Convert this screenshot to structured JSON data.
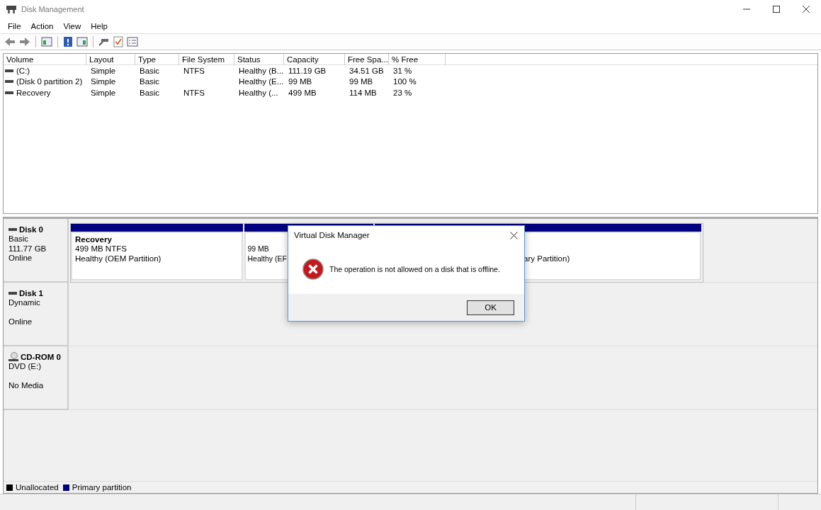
{
  "window": {
    "title": "Disk Management"
  },
  "menu": [
    "File",
    "Action",
    "View",
    "Help"
  ],
  "table": {
    "columns": [
      "Volume",
      "Layout",
      "Type",
      "File System",
      "Status",
      "Capacity",
      "Free Spa...",
      "% Free"
    ],
    "rows": [
      [
        "(C:)",
        "Simple",
        "Basic",
        "NTFS",
        "Healthy (B...",
        "111.19 GB",
        "34.51 GB",
        "31 %"
      ],
      [
        "(Disk 0 partition 2)",
        "Simple",
        "Basic",
        "",
        "Healthy (E...",
        "99 MB",
        "99 MB",
        "100 %"
      ],
      [
        "Recovery",
        "Simple",
        "Basic",
        "NTFS",
        "Healthy (...",
        "499 MB",
        "114 MB",
        "23 %"
      ]
    ]
  },
  "disks": [
    {
      "kind": "hdd",
      "name": "Disk 0",
      "type": "Basic",
      "size": "111.77 GB",
      "status": "Online",
      "partitions": [
        {
          "color": "#000080",
          "title": "Recovery",
          "size": "499 MB NTFS",
          "status": "Healthy (OEM Partition)"
        },
        {
          "color": "#000080",
          "size": "99 MB",
          "status": "Healthy (EF"
        },
        {
          "color": "#000080",
          "status": "ary Partition)"
        }
      ]
    },
    {
      "kind": "hdd",
      "name": "Disk 1",
      "type": "Dynamic",
      "status": "Online"
    },
    {
      "kind": "cdrom",
      "name": "CD-ROM 0",
      "type": "DVD (E:)",
      "status": "No Media"
    }
  ],
  "legend": [
    {
      "label": "Unallocated",
      "color": "#000000"
    },
    {
      "label": "Primary partition",
      "color": "#000080"
    }
  ],
  "dialog": {
    "title": "Virtual Disk Manager",
    "message": "The operation is not allowed on a disk that is offline.",
    "button": "OK"
  }
}
